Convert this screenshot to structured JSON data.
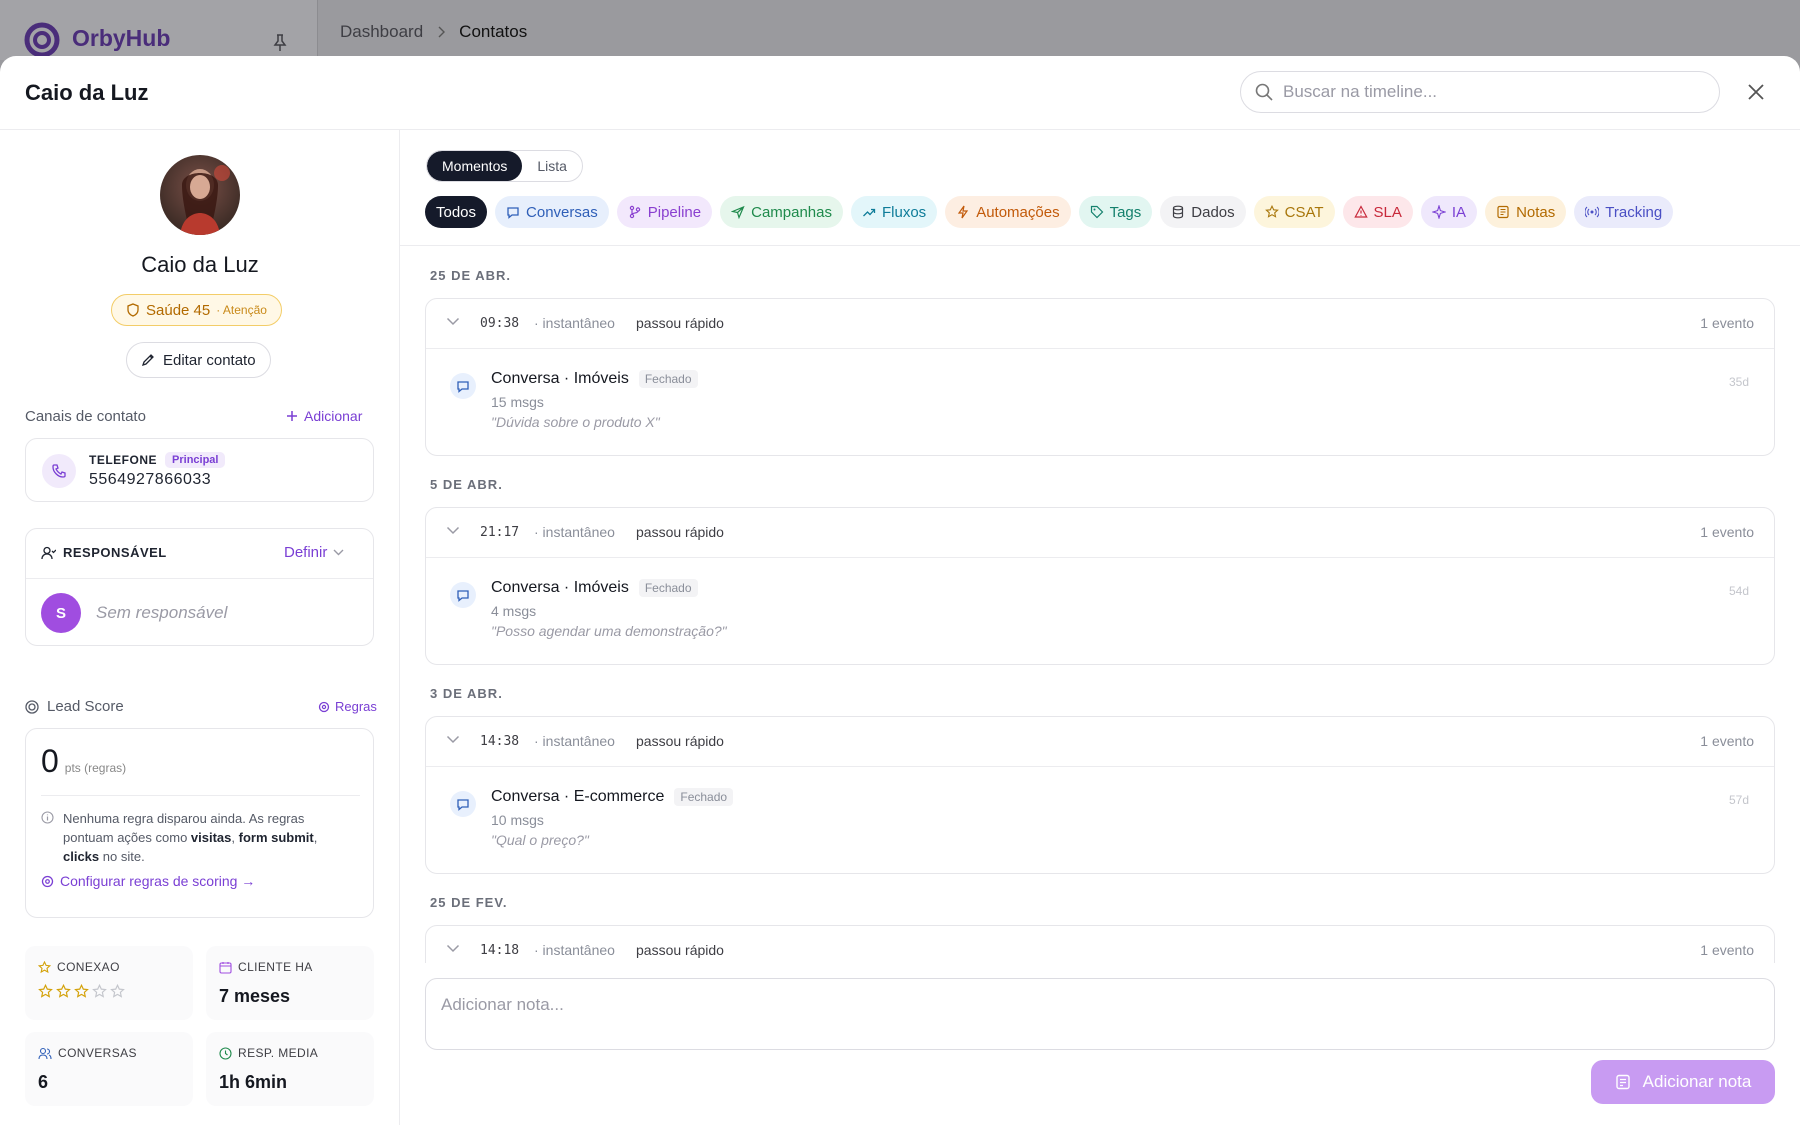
{
  "background": {
    "app_name": "OrbyHub",
    "breadcrumbs": [
      "Dashboard",
      "Contatos"
    ]
  },
  "modal": {
    "title": "Caio da Luz",
    "search_placeholder": "Buscar na timeline..."
  },
  "contact": {
    "name": "Caio da Luz",
    "health_label": "Saúde 45",
    "health_status": "· Atenção",
    "edit_label": "Editar contato"
  },
  "channels": {
    "title": "Canais de contato",
    "add_label": "Adicionar",
    "phone_label": "TELEFONE",
    "phone_badge": "Principal",
    "phone_number": "5564927866033"
  },
  "responsible": {
    "title": "RESPONSÁVEL",
    "define_label": "Definir",
    "avatar_initial": "S",
    "none_label": "Sem responsável"
  },
  "lead_score": {
    "title": "Lead Score",
    "rules_link": "Regras",
    "points": "0",
    "points_unit": "pts (regras)",
    "info_1": "Nenhuma regra disparou ainda. As regras pontuam ações como ",
    "info_b1": "visitas",
    "info_2": ", ",
    "info_b2": "form submit",
    "info_3": ", ",
    "info_b3": "clicks",
    "info_4": " no site.",
    "config_link": "Configurar regras de scoring →"
  },
  "stats": {
    "conexao_label": "CONEXAO",
    "conexao_stars": 3,
    "conexao_max": 5,
    "cliente_label": "CLIENTE HA",
    "cliente_value": "7 meses",
    "conversas_label": "CONVERSAS",
    "conversas_value": "6",
    "resp_label": "RESP. MEDIA",
    "resp_value": "1h 6min"
  },
  "view_toggle": {
    "momentos": "Momentos",
    "lista": "Lista"
  },
  "filters": [
    {
      "label": "Todos",
      "icon": "none",
      "color": "#151a2a",
      "bg": "#151a2a",
      "active": true
    },
    {
      "label": "Conversas",
      "icon": "chat-icon",
      "color": "#2f5fb8",
      "bg": "#e7effc"
    },
    {
      "label": "Pipeline",
      "icon": "branch-icon",
      "color": "#8a3fd0",
      "bg": "#f2e8fc"
    },
    {
      "label": "Campanhas",
      "icon": "send-icon",
      "color": "#1f8a4c",
      "bg": "#e6f6ec"
    },
    {
      "label": "Fluxos",
      "icon": "trend-icon",
      "color": "#0e7c99",
      "bg": "#e3f6fa"
    },
    {
      "label": "Automações",
      "icon": "bolt-icon",
      "color": "#c25a0a",
      "bg": "#fdeee2"
    },
    {
      "label": "Tags",
      "icon": "tag-icon",
      "color": "#14816d",
      "bg": "#e2f6f1"
    },
    {
      "label": "Dados",
      "icon": "database-icon",
      "color": "#3e3e44",
      "bg": "#f3f3f5"
    },
    {
      "label": "CSAT",
      "icon": "star-icon",
      "color": "#a8760a",
      "bg": "#fdf5dc"
    },
    {
      "label": "SLA",
      "icon": "alert-icon",
      "color": "#c8283a",
      "bg": "#fde7ea"
    },
    {
      "label": "IA",
      "icon": "sparkle-icon",
      "color": "#7a3fd4",
      "bg": "#efe8fc"
    },
    {
      "label": "Notas",
      "icon": "note-icon",
      "color": "#b26a00",
      "bg": "#fdf1dc"
    },
    {
      "label": "Tracking",
      "icon": "radio-icon",
      "color": "#4a4fc4",
      "bg": "#eaebfb"
    }
  ],
  "timeline": [
    {
      "date": "25 DE ABR.",
      "time": "09:38",
      "inst": "· instantâneo",
      "fast": "passou rápido",
      "count": "1 evento",
      "title": "Conversa · Imóveis",
      "status": "Fechado",
      "msgs": "15 msgs",
      "quote": "\"Dúvida sobre o produto X\"",
      "age": "35d"
    },
    {
      "date": "5 DE ABR.",
      "time": "21:17",
      "inst": "· instantâneo",
      "fast": "passou rápido",
      "count": "1 evento",
      "title": "Conversa · Imóveis",
      "status": "Fechado",
      "msgs": "4 msgs",
      "quote": "\"Posso agendar uma demonstração?\"",
      "age": "54d"
    },
    {
      "date": "3 DE ABR.",
      "time": "14:38",
      "inst": "· instantâneo",
      "fast": "passou rápido",
      "count": "1 evento",
      "title": "Conversa · E-commerce",
      "status": "Fechado",
      "msgs": "10 msgs",
      "quote": "\"Qual o preço?\"",
      "age": "57d"
    },
    {
      "date": "25 DE FEV.",
      "time": "14:18",
      "inst": "· instantâneo",
      "fast": "passou rápido",
      "count": "1 evento"
    }
  ],
  "note": {
    "placeholder": "Adicionar nota...",
    "button": "Adicionar nota"
  },
  "colors": {
    "accent": "#7a3fd4",
    "dark": "#151a2a",
    "health": "#b26a00"
  }
}
